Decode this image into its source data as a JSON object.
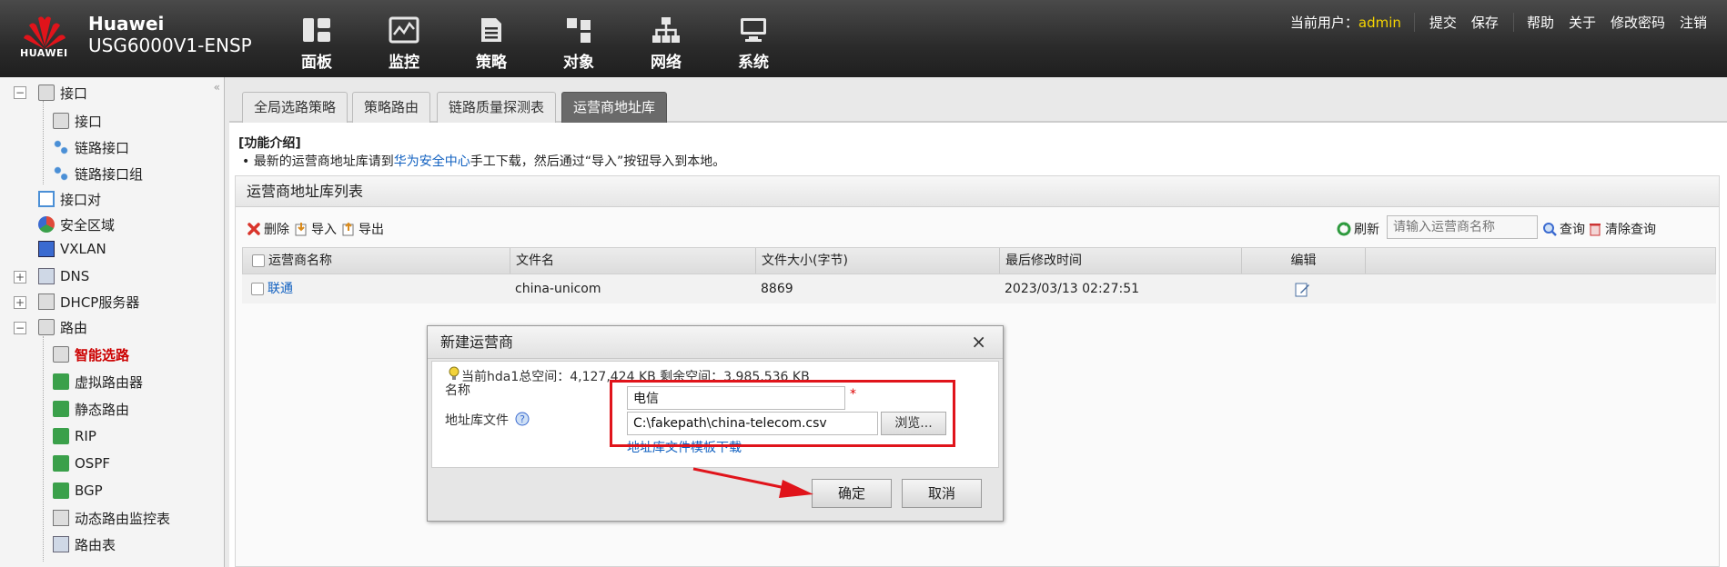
{
  "header": {
    "brand": "Huawei",
    "model": "USG6000V1-ENSP",
    "logo_text": "HUAWEI",
    "nav": [
      {
        "label": "面板",
        "icon": "dashboard-icon"
      },
      {
        "label": "监控",
        "icon": "monitor-icon"
      },
      {
        "label": "策略",
        "icon": "policy-icon"
      },
      {
        "label": "对象",
        "icon": "object-icon"
      },
      {
        "label": "网络",
        "icon": "network-icon"
      },
      {
        "label": "系统",
        "icon": "system-icon"
      }
    ],
    "current_user_label": "当前用户：",
    "current_user": "admin",
    "commit": "提交",
    "save": "保存",
    "help": "帮助",
    "about": "关于",
    "change_password": "修改密码",
    "logout": "注销"
  },
  "sidebar": {
    "collapse": "«",
    "items": {
      "interface": "接口",
      "interface_child": "接口",
      "link_interface": "链路接口",
      "link_interface_group": "链路接口组",
      "interface_pair": "接口对",
      "security_zone": "安全区域",
      "vxlan": "VXLAN",
      "dns": "DNS",
      "dhcp": "DHCP服务器",
      "routing": "路由",
      "smart_routing": "智能选路",
      "virtual_router": "虚拟路由器",
      "static_route": "静态路由",
      "rip": "RIP",
      "ospf": "OSPF",
      "bgp": "BGP",
      "dynamic_monitor": "动态路由监控表",
      "routing_table": "路由表"
    }
  },
  "tabs": [
    "全局选路策略",
    "策略路由",
    "链路质量探测表",
    "运营商地址库"
  ],
  "intro": {
    "title": "[功能介绍]",
    "prefix": "• 最新的运营商地址库请到",
    "link": "华为安全中心",
    "suffix": "手工下载，然后通过“导入”按钮导入到本地。"
  },
  "panel": {
    "title": "运营商地址库列表",
    "delete": "删除",
    "import": "导入",
    "export": "导出",
    "refresh": "刷新",
    "search_placeholder": "请输入运营商名称",
    "query": "查询",
    "clear_query": "清除查询"
  },
  "table": {
    "columns": [
      "运营商名称",
      "文件名",
      "文件大小(字节)",
      "最后修改时间",
      "编辑"
    ],
    "rows": [
      {
        "name": "联通",
        "file": "china-unicom",
        "size": "8869",
        "modified": "2023/03/13 02:27:51"
      }
    ]
  },
  "dialog": {
    "title": "新建运营商",
    "close": "×",
    "space_info": "当前hda1总空间：4,127,424 KB    剩余空间：3,985,536 KB",
    "name_label": "名称",
    "name_value": "电信",
    "required": "*",
    "file_label": "地址库文件",
    "file_value": "C:\\fakepath\\china-telecom.csv",
    "browse": "浏览...",
    "template_link": "地址库文件模板下载",
    "ok": "确定",
    "cancel": "取消"
  },
  "colors": {
    "accent_red": "#e0141b",
    "link_blue": "#1060c0",
    "user_yellow": "#f5d400"
  }
}
